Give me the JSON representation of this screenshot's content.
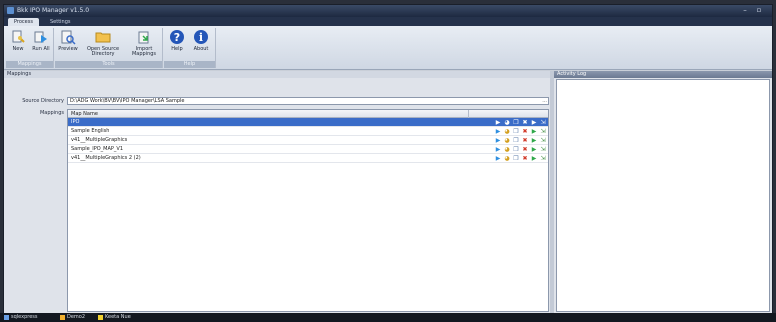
{
  "window": {
    "title": "Bkk IPO Manager v1.5.0"
  },
  "tabs": [
    {
      "label": "Process"
    },
    {
      "label": "Settings"
    }
  ],
  "ribbon": {
    "groups": [
      {
        "label": "Mappings",
        "buttons": [
          {
            "label": "New",
            "icon": "new-mapping-icon"
          },
          {
            "label": "Run All",
            "icon": "run-all-icon"
          }
        ]
      },
      {
        "label": "Tools",
        "buttons": [
          {
            "label": "Preview",
            "icon": "preview-icon"
          },
          {
            "label": "Open Source Directory",
            "icon": "folder-icon"
          },
          {
            "label": "Import Mappings",
            "icon": "import-icon"
          }
        ]
      },
      {
        "label": "Help",
        "buttons": [
          {
            "label": "Help",
            "icon": "help-icon"
          },
          {
            "label": "About",
            "icon": "info-icon"
          }
        ]
      }
    ]
  },
  "mappings_panel": {
    "header": "Mappings",
    "source_label": "Source Directory",
    "source_value": "D:\\ADG Work\\BV\\BV\\IPO Manager\\LSA Sample",
    "browse": "...",
    "mappings_label": "Mappings",
    "column": "Map Name",
    "rows": [
      {
        "name": "IPO",
        "selected": true
      },
      {
        "name": "Sample English",
        "selected": false
      },
      {
        "name": "v41__MultipleGraphics",
        "selected": false
      },
      {
        "name": "Sample_IPO_MAP_V1",
        "selected": false
      },
      {
        "name": "v41__MultipleGraphics 2 (2)",
        "selected": false
      }
    ]
  },
  "activity_panel": {
    "header": "Activity Log"
  },
  "colors": {
    "accent": "#3a6cc8",
    "run": "#2f8fe0",
    "delete": "#d23a2a",
    "play": "#2fa84a"
  },
  "taskbar": {
    "items": [
      {
        "label": "sqlexpress"
      },
      {
        "label": "Demo2"
      },
      {
        "label": "Keeta Nue"
      }
    ]
  }
}
